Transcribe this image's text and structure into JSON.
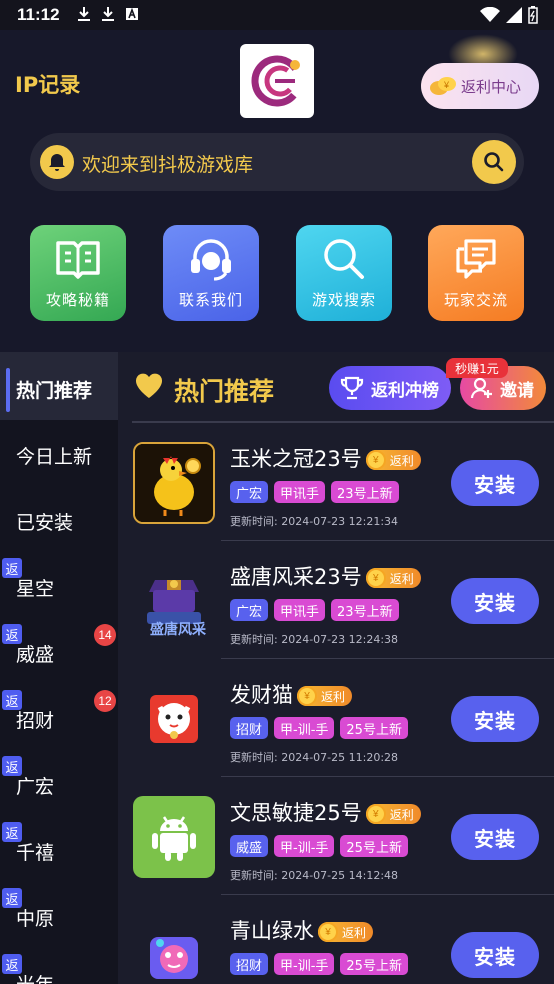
{
  "status_bar": {
    "time": "11:12"
  },
  "header": {
    "ip_title": "IP记录",
    "rebate_center": "返利中心",
    "search_text": "欢迎来到抖极游戏库"
  },
  "quick_actions": [
    {
      "label": "攻略秘籍",
      "icon": "book-icon"
    },
    {
      "label": "联系我们",
      "icon": "headset-icon"
    },
    {
      "label": "游戏搜索",
      "icon": "search-icon"
    },
    {
      "label": "玩家交流",
      "icon": "chat-icon"
    }
  ],
  "sidebar": {
    "active": "热门推荐",
    "items": [
      {
        "label": "今日上新"
      },
      {
        "label": "已安装"
      },
      {
        "label": "星空",
        "fan": "返"
      },
      {
        "label": "威盛",
        "fan": "返",
        "badge": "14"
      },
      {
        "label": "招财",
        "fan": "返",
        "badge": "12"
      },
      {
        "label": "广宏",
        "fan": "返"
      },
      {
        "label": "千禧",
        "fan": "返"
      },
      {
        "label": "中原",
        "fan": "返"
      },
      {
        "label": "光年",
        "fan": "返"
      }
    ]
  },
  "main": {
    "title": "热门推荐",
    "rank_button": "返利冲榜",
    "invite_button": "邀请",
    "earn_tag": "秒赚1元",
    "fanli_label": "返利",
    "coin": "¥",
    "install_label": "安装",
    "games": [
      {
        "name": "玉米之冠23号",
        "tags": [
          "广宏",
          "甲讯手",
          "23号上新"
        ],
        "time": "更新时间: 2024-07-23 12:21:34",
        "icon": "chicken-game-icon"
      },
      {
        "name": "盛唐风采23号",
        "tags": [
          "广宏",
          "甲讯手",
          "23号上新"
        ],
        "time": "更新时间: 2024-07-23 12:24:38",
        "icon": "treasure-chest-game-icon"
      },
      {
        "name": "发财猫",
        "tags": [
          "招财",
          "甲-训-手",
          "25号上新"
        ],
        "time": "更新时间: 2024-07-25 11:20:28",
        "icon": "lucky-cat-game-icon"
      },
      {
        "name": "文思敏捷25号",
        "tags": [
          "威盛",
          "甲-训-手",
          "25号上新"
        ],
        "time": "更新时间: 2024-07-25 14:12:48",
        "icon": "android-icon"
      },
      {
        "name": "青山绿水",
        "tags": [
          "招财",
          "甲-训-手",
          "25号上新"
        ],
        "time": "",
        "icon": "cartoon-game-icon"
      }
    ]
  },
  "colors": {
    "accent_yellow": "#f2c94c",
    "accent_blue": "#5861ee",
    "tag_pink": "#d94bd3",
    "background": "#1b1c2b"
  }
}
